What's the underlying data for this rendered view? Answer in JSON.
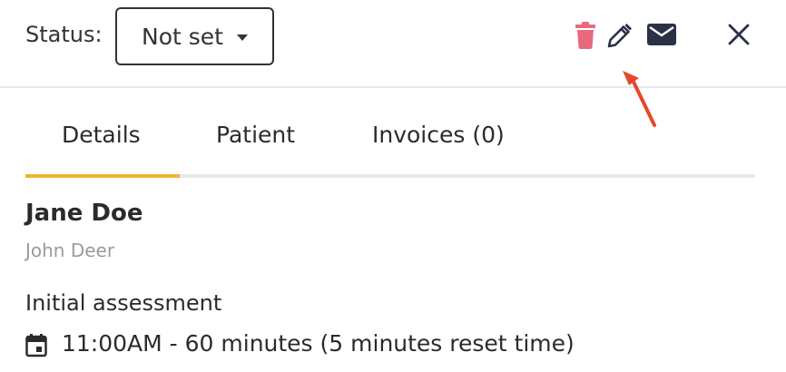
{
  "header": {
    "status_label": "Status:",
    "status_value": "Not set",
    "icons": [
      "trash-icon",
      "pencil-icon",
      "mail-icon",
      "close-icon"
    ],
    "colors": {
      "trash": "#e8697d",
      "icon_dark": "#2a3146",
      "arrow": "#e8472b"
    }
  },
  "tabs": [
    {
      "label": "Details",
      "active": true
    },
    {
      "label": "Patient",
      "active": false
    },
    {
      "label": "Invoices (0)",
      "active": false
    }
  ],
  "tab_accent": "#f0b233",
  "appointment": {
    "patient_name": "Jane Doe",
    "practitioner": "John Deer",
    "type": "Initial assessment",
    "time": "11:00AM - 60 minutes (5 minutes reset time)"
  }
}
